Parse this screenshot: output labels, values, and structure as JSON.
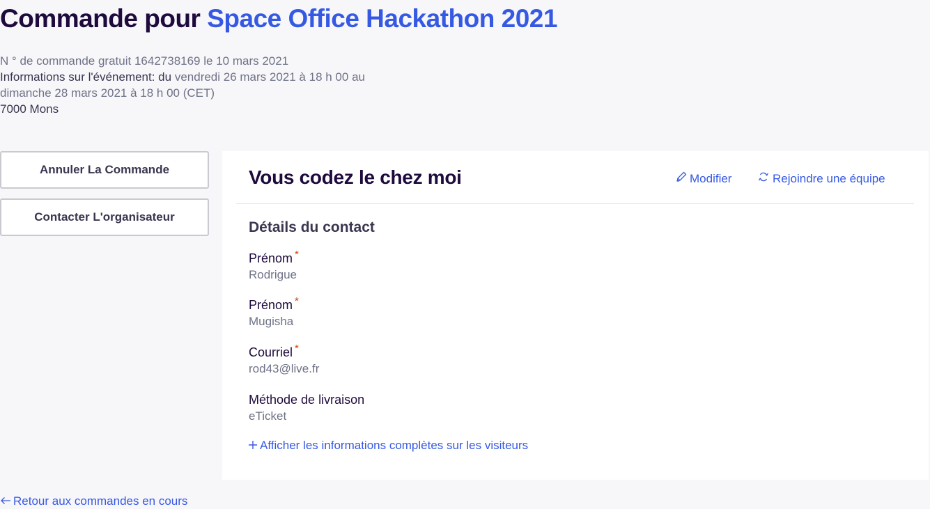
{
  "header": {
    "title_prefix": "Commande pour",
    "event_name": "Space Office Hackathon 2021"
  },
  "meta": {
    "order_label": "N ° de commande gratuit",
    "order_number": "1642738169",
    "order_date": "le 10 mars 2021",
    "event_info_label": "Informations sur l'événement: du",
    "event_start": "vendredi 26 mars 2021 à 18 h 00",
    "event_to": "au",
    "event_end": "dimanche 28 mars 2021 à 18 h 00 (CET)",
    "location": "7000 Mons"
  },
  "sidebar": {
    "cancel_label": "Annuler La Commande",
    "contact_label": "Contacter L'organisateur"
  },
  "card": {
    "title": "Vous codez le chez moi",
    "modify_label": "Modifier",
    "join_team_label": "Rejoindre une équipe",
    "section_title": "Détails du contact",
    "fields": [
      {
        "label": "Prénom",
        "required_mark": "*",
        "value": "Rodrigue"
      },
      {
        "label": "Prénom",
        "required_mark": "*",
        "value": "Mugisha"
      },
      {
        "label": "Courriel",
        "required_mark": "*",
        "value": "rod43@live.fr"
      },
      {
        "label": "Méthode de livraison",
        "value": "eTicket"
      }
    ],
    "show_more_label": "Afficher les informations complètes sur les visiteurs"
  },
  "footer": {
    "back_label": "Retour aux commandes en cours"
  },
  "icons": {
    "modify": "pencil-icon",
    "join_team": "refresh-icon",
    "show_more": "plus-icon",
    "back": "arrow-left-icon"
  },
  "colors": {
    "accent": "#3659e3",
    "title": "#1e0a3c",
    "muted": "#6f7287",
    "required": "#d1410c",
    "background": "#f7f7fa"
  }
}
